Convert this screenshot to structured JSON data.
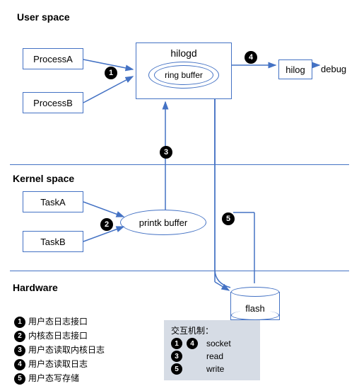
{
  "sections": {
    "user": "User space",
    "kernel": "Kernel space",
    "hardware": "Hardware"
  },
  "user": {
    "procA": "ProcessA",
    "procB": "ProcessB",
    "hilogd": "hilogd",
    "ring": "ring buffer",
    "hilog": "hilog",
    "debug": "debug"
  },
  "kernel": {
    "taskA": "TaskA",
    "taskB": "TaskB",
    "printk": "printk buffer"
  },
  "hardware": {
    "flash": "flash"
  },
  "steps": {
    "s1": "1",
    "s2": "2",
    "s3": "3",
    "s4": "4",
    "s5": "5"
  },
  "notes": {
    "n1": "用户态日志接口",
    "n2": "内核态日志接口",
    "n3": "用户态读取内核日志",
    "n4": "用户态读取日志",
    "n5": "用户态写存储"
  },
  "legend": {
    "title": "交互机制：",
    "items": [
      {
        "nums": [
          "1",
          "4"
        ],
        "label": "socket"
      },
      {
        "nums": [
          "3"
        ],
        "label": "read"
      },
      {
        "nums": [
          "5"
        ],
        "label": "write"
      }
    ]
  }
}
